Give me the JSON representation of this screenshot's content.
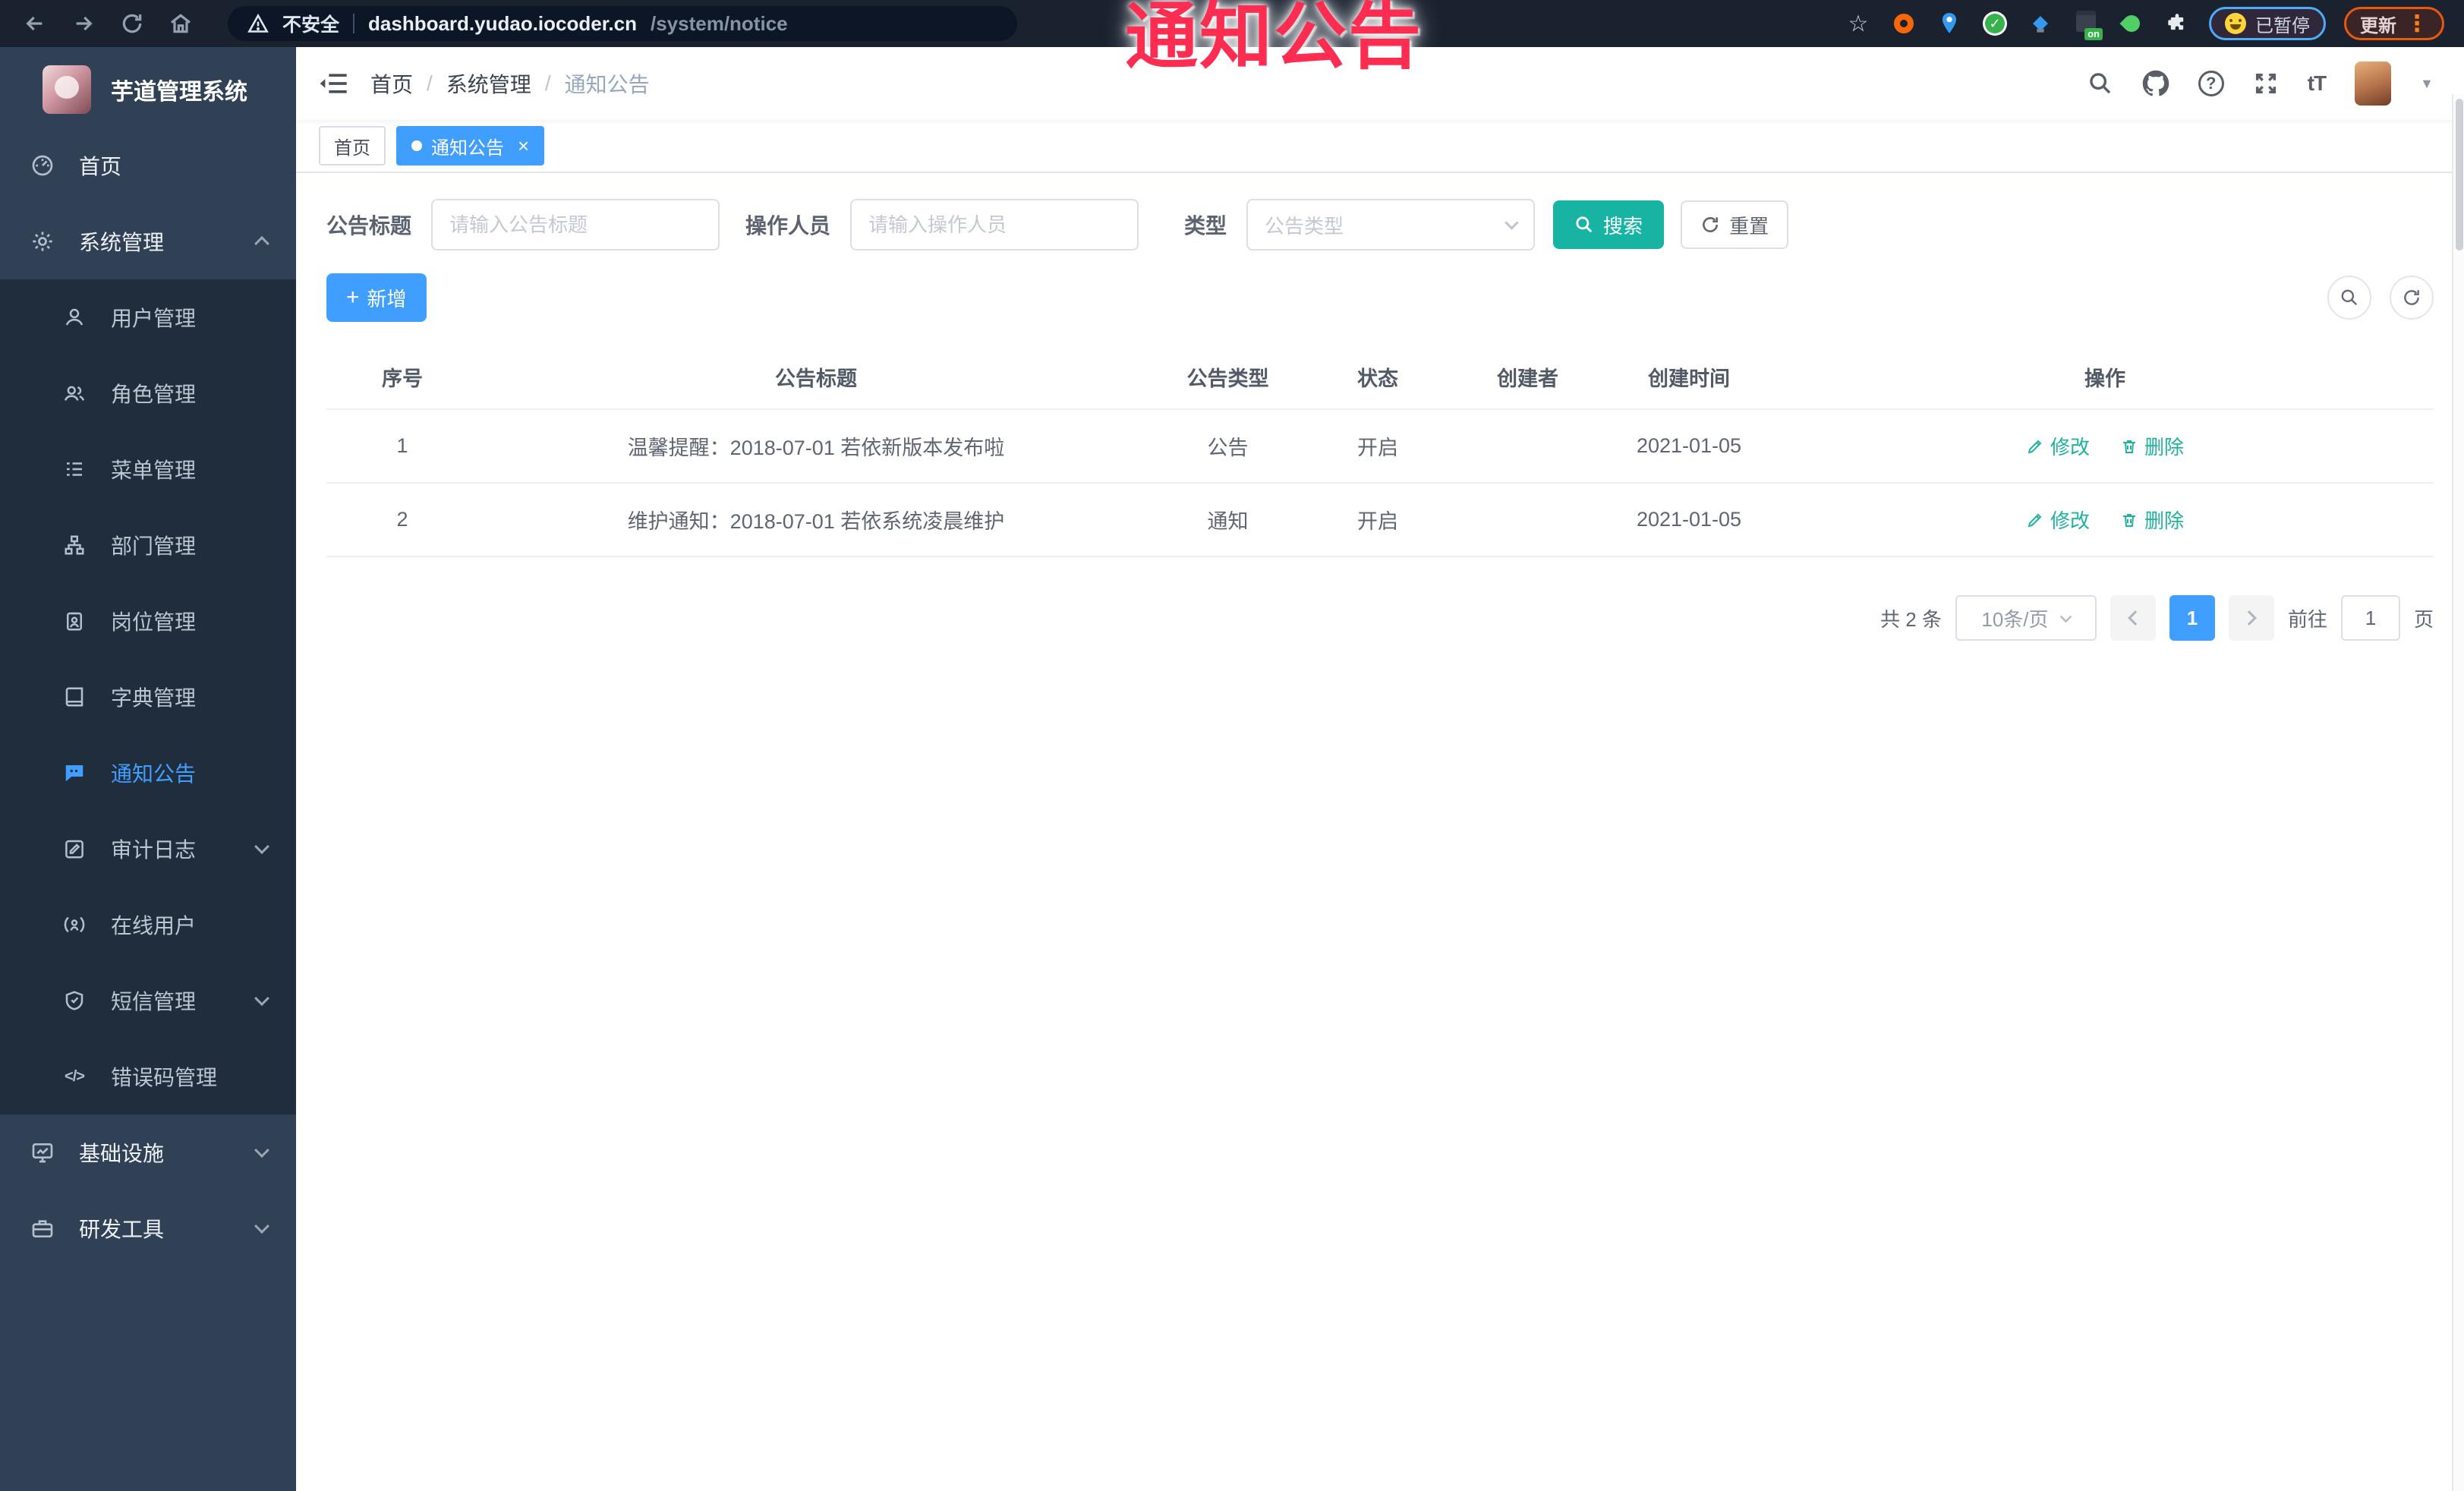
{
  "overlay": {
    "caption": "通知公告",
    "color": "#fc2d50"
  },
  "browser": {
    "security_label": "不安全",
    "url_host": "dashboard.yudao.iocoder.cn",
    "url_path": "/system/notice",
    "extension_on_badge": "on",
    "paused_label": "已暂停",
    "update_label": "更新"
  },
  "sidebar": {
    "app_title": "芋道管理系统",
    "home": {
      "label": "首页",
      "icon": "dashboard-icon"
    },
    "system": {
      "label": "系统管理",
      "icon": "gear-icon",
      "expanded": true
    },
    "sub": [
      {
        "label": "用户管理",
        "icon": "user-icon"
      },
      {
        "label": "角色管理",
        "icon": "roles-icon"
      },
      {
        "label": "菜单管理",
        "icon": "menu-list-icon"
      },
      {
        "label": "部门管理",
        "icon": "org-tree-icon"
      },
      {
        "label": "岗位管理",
        "icon": "post-badge-icon"
      },
      {
        "label": "字典管理",
        "icon": "dict-book-icon"
      },
      {
        "label": "通知公告",
        "icon": "notice-bubble-icon",
        "active": true
      },
      {
        "label": "审计日志",
        "icon": "audit-log-icon",
        "expandable": true
      },
      {
        "label": "在线用户",
        "icon": "online-user-icon"
      },
      {
        "label": "短信管理",
        "icon": "sms-shield-icon",
        "expandable": true
      },
      {
        "label": "错误码管理",
        "icon": "error-code-icon"
      }
    ],
    "infra": {
      "label": "基础设施",
      "icon": "monitor-icon"
    },
    "devtools": {
      "label": "研发工具",
      "icon": "toolbox-icon"
    }
  },
  "navbar": {
    "breadcrumb": [
      "首页",
      "系统管理",
      "通知公告"
    ],
    "separator": "/"
  },
  "tabs": [
    {
      "label": "首页",
      "active": false
    },
    {
      "label": "通知公告",
      "active": true,
      "close": "×"
    }
  ],
  "filters": {
    "title_label": "公告标题",
    "title_placeholder": "请输入公告标题",
    "operator_label": "操作人员",
    "operator_placeholder": "请输入操作人员",
    "type_label": "类型",
    "type_placeholder": "公告类型",
    "search_label": "搜索",
    "reset_label": "重置"
  },
  "toolbar": {
    "add_label": "新增"
  },
  "table": {
    "headers": [
      "序号",
      "公告标题",
      "公告类型",
      "状态",
      "创建者",
      "创建时间",
      "操作"
    ],
    "rows": [
      {
        "no": "1",
        "title": "温馨提醒：2018-07-01 若依新版本发布啦",
        "type": "公告",
        "status": "开启",
        "creator": "",
        "created": "2021-01-05",
        "edit": "修改",
        "del": "删除"
      },
      {
        "no": "2",
        "title": "维护通知：2018-07-01 若依系统凌晨维护",
        "type": "通知",
        "status": "开启",
        "creator": "",
        "created": "2021-01-05",
        "edit": "修改",
        "del": "删除"
      }
    ]
  },
  "pagination": {
    "total": "共 2 条",
    "page_size": "10条/页",
    "page": "1",
    "goto_label": "前往",
    "goto_value": "1",
    "page_unit": "页"
  },
  "icons": {
    "help_glyph": "?",
    "font_size_glyph": "tT",
    "caret_glyph": "▼",
    "kebab_glyph": "⋮",
    "check_glyph": "✓",
    "code_glyph": "</>",
    "plus_glyph": "+",
    "star_glyph": "☆"
  },
  "colors": {
    "accent_blue": "#409eff",
    "search_teal": "#17b3a3",
    "overlay_red": "#fc2d50",
    "sidebar_bg": "#304156",
    "submenu_bg": "#1f2d3d",
    "action_link": "#1fb39f"
  }
}
